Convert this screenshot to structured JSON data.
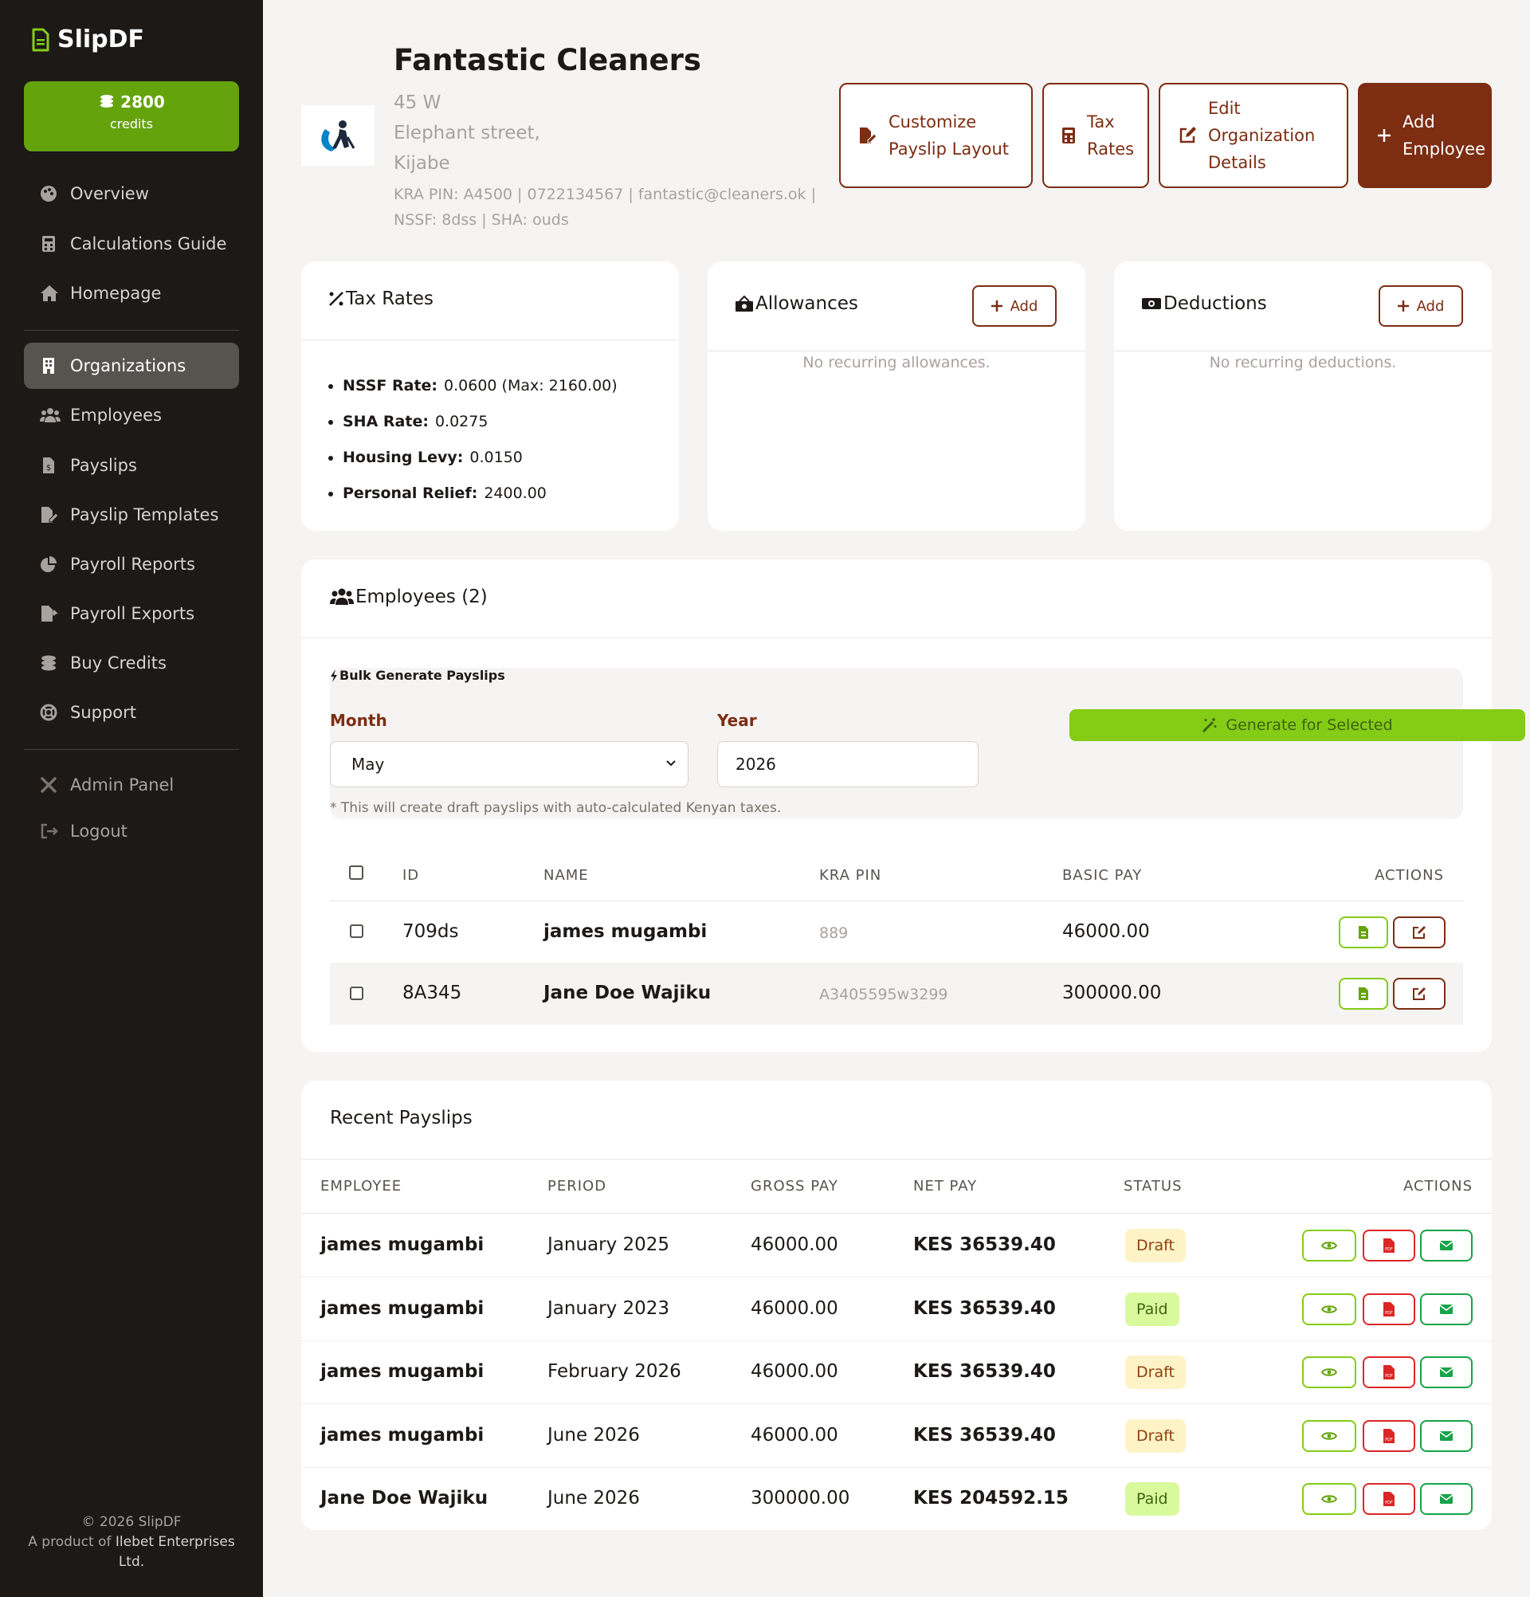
{
  "brand": {
    "name": "SlipDF"
  },
  "credits": {
    "amount": "2800",
    "label": "credits"
  },
  "nav": {
    "overview": "Overview",
    "calc_guide": "Calculations Guide",
    "homepage": "Homepage",
    "organizations": "Organizations",
    "employees": "Employees",
    "payslips": "Payslips",
    "templates": "Payslip Templates",
    "reports": "Payroll Reports",
    "exports": "Payroll Exports",
    "buy_credits": "Buy Credits",
    "support": "Support",
    "admin": "Admin Panel",
    "logout": "Logout"
  },
  "footer": {
    "copyright": "© 2026 SlipDF",
    "product_prefix": "A product of",
    "company": "Ilebet Enterprises Ltd."
  },
  "org": {
    "name": "Fantastic Cleaners",
    "address_lines": [
      "45 W",
      "Elephant street,",
      "Kijabe"
    ],
    "meta_line1": "KRA PIN: A4500 | 0722134567 | fantastic@cleaners.ok |",
    "meta_line2": "NSSF: 8dss | SHA: ouds"
  },
  "header_buttons": {
    "customize": [
      "Customize",
      "Payslip Layout"
    ],
    "tax": [
      "Tax",
      "Rates"
    ],
    "edit": [
      "Edit",
      "Organization",
      "Details"
    ],
    "add_employee": [
      "Add",
      "Employee"
    ]
  },
  "tax_card": {
    "title": "Tax Rates",
    "items": [
      {
        "label": "NSSF Rate:",
        "value": "0.0600 (Max: 2160.00)"
      },
      {
        "label": "SHA Rate:",
        "value": "0.0275"
      },
      {
        "label": "Housing Levy:",
        "value": "0.0150"
      },
      {
        "label": "Personal Relief:",
        "value": "2400.00"
      }
    ]
  },
  "allowances": {
    "title": "Allowances",
    "add_label": "Add",
    "empty": "No recurring allowances."
  },
  "deductions": {
    "title": "Deductions",
    "add_label": "Add",
    "empty": "No recurring deductions."
  },
  "employees_card": {
    "title": "Employees (2)",
    "bulk": {
      "title": "Bulk Generate Payslips",
      "month_label": "Month",
      "month_value": "May",
      "year_label": "Year",
      "year_value": "2026",
      "generate_label": "Generate for Selected",
      "note": "* This will create draft payslips with auto-calculated Kenyan taxes."
    },
    "columns": [
      "ID",
      "NAME",
      "KRA PIN",
      "BASIC PAY",
      "ACTIONS"
    ],
    "rows": [
      {
        "id": "709ds",
        "name": "james mugambi",
        "kra": "889",
        "pay": "46000.00"
      },
      {
        "id": "8A345",
        "name": "Jane Doe Wajiku",
        "kra": "A3405595w3299",
        "pay": "300000.00"
      }
    ]
  },
  "recent_payslips": {
    "title": "Recent Payslips",
    "columns": [
      "EMPLOYEE",
      "PERIOD",
      "GROSS PAY",
      "NET PAY",
      "STATUS",
      "ACTIONS"
    ],
    "rows": [
      {
        "employee": "james mugambi",
        "period": "January 2025",
        "gross": "46000.00",
        "net": "KES 36539.40",
        "status": "Draft"
      },
      {
        "employee": "james mugambi",
        "period": "January 2023",
        "gross": "46000.00",
        "net": "KES 36539.40",
        "status": "Paid"
      },
      {
        "employee": "james mugambi",
        "period": "February 2026",
        "gross": "46000.00",
        "net": "KES 36539.40",
        "status": "Draft"
      },
      {
        "employee": "james mugambi",
        "period": "June 2026",
        "gross": "46000.00",
        "net": "KES 36539.40",
        "status": "Draft"
      },
      {
        "employee": "Jane Doe Wajiku",
        "period": "June 2026",
        "gross": "300000.00",
        "net": "KES 204592.15",
        "status": "Paid"
      }
    ]
  },
  "colors": {
    "sidebar_bg": "#1c1917",
    "accent_brown": "#7c2d12",
    "accent_green": "#65a30d",
    "lime": "#84cc16",
    "pdf_red": "#dc2626",
    "email_green": "#16a34a"
  }
}
